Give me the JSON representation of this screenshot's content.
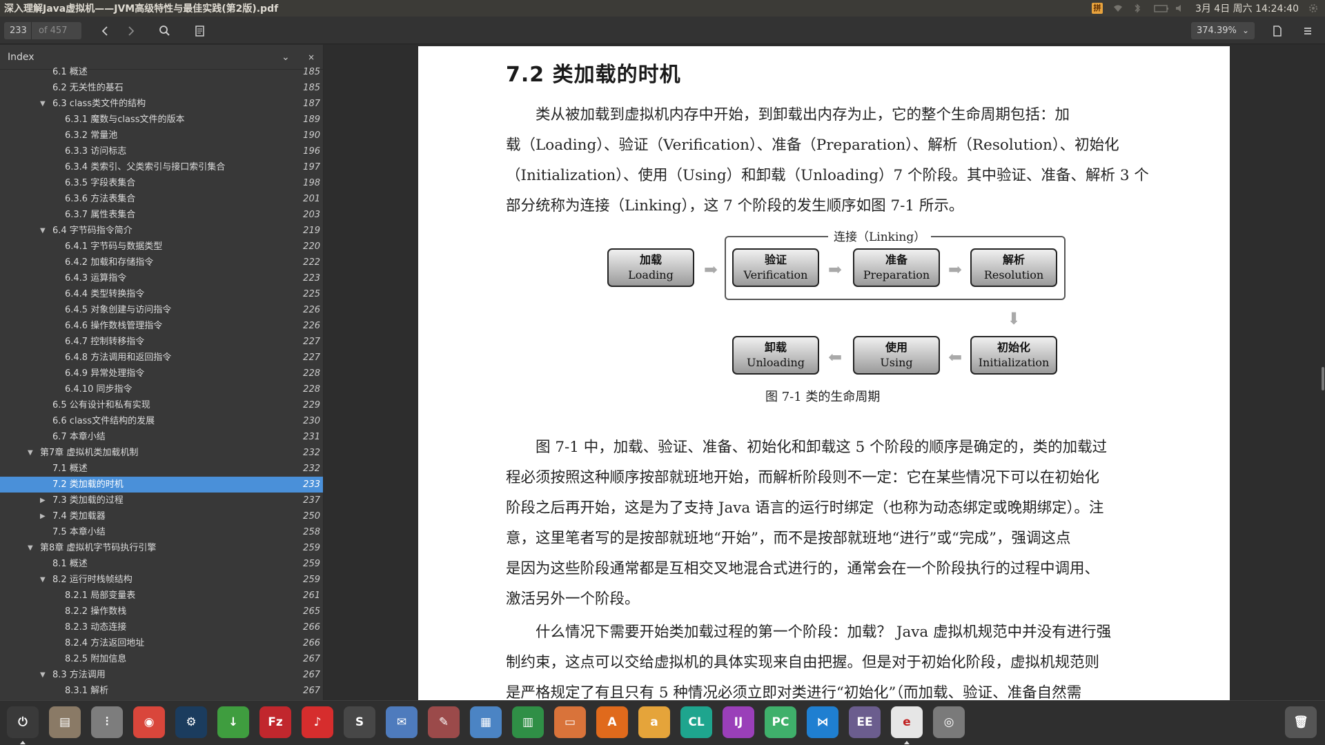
{
  "window": {
    "title": "深入理解Java虚拟机——JVM高级特性与最佳实践(第2版).pdf"
  },
  "tray": {
    "ime_label": "拼",
    "datetime": "3月 4日 周六 14:24:40"
  },
  "toolbar": {
    "current_page": "233",
    "total_pages": "of 457",
    "zoom": "374.39%"
  },
  "sidebar": {
    "title": "Index",
    "close_glyph": "×",
    "dropdown_glyph": "⌄",
    "items": [
      {
        "label": "6.1    概述",
        "page": "185",
        "level": 1,
        "twisty": ""
      },
      {
        "label": "6.2    无关性的基石",
        "page": "185",
        "level": 1,
        "twisty": ""
      },
      {
        "label": "6.3 class类文件的结构",
        "page": "187",
        "level": 1,
        "twisty": "open"
      },
      {
        "label": "6.3.1    魔数与class文件的版本",
        "page": "189",
        "level": 2,
        "twisty": ""
      },
      {
        "label": "6.3.2    常量池",
        "page": "190",
        "level": 2,
        "twisty": ""
      },
      {
        "label": "6.3.3    访问标志",
        "page": "196",
        "level": 2,
        "twisty": ""
      },
      {
        "label": "6.3.4    类索引、父类索引与接口索引集合",
        "page": "197",
        "level": 2,
        "twisty": ""
      },
      {
        "label": "6.3.5    字段表集合",
        "page": "198",
        "level": 2,
        "twisty": ""
      },
      {
        "label": "6.3.6    方法表集合",
        "page": "201",
        "level": 2,
        "twisty": ""
      },
      {
        "label": "6.3.7    属性表集合",
        "page": "203",
        "level": 2,
        "twisty": ""
      },
      {
        "label": "6.4    字节码指令简介",
        "page": "219",
        "level": 1,
        "twisty": "open"
      },
      {
        "label": "6.4.1    字节码与数据类型",
        "page": "220",
        "level": 2,
        "twisty": ""
      },
      {
        "label": "6.4.2    加载和存储指令",
        "page": "222",
        "level": 2,
        "twisty": ""
      },
      {
        "label": "6.4.3    运算指令",
        "page": "223",
        "level": 2,
        "twisty": ""
      },
      {
        "label": "6.4.4    类型转换指令",
        "page": "225",
        "level": 2,
        "twisty": ""
      },
      {
        "label": "6.4.5    对象创建与访问指令",
        "page": "226",
        "level": 2,
        "twisty": ""
      },
      {
        "label": "6.4.6    操作数栈管理指令",
        "page": "226",
        "level": 2,
        "twisty": ""
      },
      {
        "label": "6.4.7    控制转移指令",
        "page": "227",
        "level": 2,
        "twisty": ""
      },
      {
        "label": "6.4.8    方法调用和返回指令",
        "page": "227",
        "level": 2,
        "twisty": ""
      },
      {
        "label": "6.4.9    异常处理指令",
        "page": "228",
        "level": 2,
        "twisty": ""
      },
      {
        "label": "6.4.10    同步指令",
        "page": "228",
        "level": 2,
        "twisty": ""
      },
      {
        "label": "6.5    公有设计和私有实现",
        "page": "229",
        "level": 1,
        "twisty": ""
      },
      {
        "label": "6.6 class文件结构的发展",
        "page": "230",
        "level": 1,
        "twisty": ""
      },
      {
        "label": "6.7    本章小结",
        "page": "231",
        "level": 1,
        "twisty": ""
      },
      {
        "label": "第7章    虚拟机类加载机制",
        "page": "232",
        "level": 0,
        "twisty": "open"
      },
      {
        "label": "7.1    概述",
        "page": "232",
        "level": 1,
        "twisty": ""
      },
      {
        "label": "7.2    类加载的时机",
        "page": "233",
        "level": 1,
        "twisty": "",
        "selected": true
      },
      {
        "label": "7.3    类加载的过程",
        "page": "237",
        "level": 1,
        "twisty": "closed"
      },
      {
        "label": "7.4    类加载器",
        "page": "250",
        "level": 1,
        "twisty": "closed"
      },
      {
        "label": "7.5    本章小结",
        "page": "258",
        "level": 1,
        "twisty": ""
      },
      {
        "label": "第8章    虚拟机字节码执行引擎",
        "page": "259",
        "level": 0,
        "twisty": "open"
      },
      {
        "label": "8.1    概述",
        "page": "259",
        "level": 1,
        "twisty": ""
      },
      {
        "label": "8.2    运行时栈帧结构",
        "page": "259",
        "level": 1,
        "twisty": "open"
      },
      {
        "label": "8.2.1    局部变量表",
        "page": "261",
        "level": 2,
        "twisty": ""
      },
      {
        "label": "8.2.2    操作数栈",
        "page": "265",
        "level": 2,
        "twisty": ""
      },
      {
        "label": "8.2.3    动态连接",
        "page": "266",
        "level": 2,
        "twisty": ""
      },
      {
        "label": "8.2.4    方法返回地址",
        "page": "266",
        "level": 2,
        "twisty": ""
      },
      {
        "label": "8.2.5    附加信息",
        "page": "267",
        "level": 2,
        "twisty": ""
      },
      {
        "label": "8.3    方法调用",
        "page": "267",
        "level": 1,
        "twisty": "open"
      },
      {
        "label": "8.3.1    解析",
        "page": "267",
        "level": 2,
        "twisty": ""
      }
    ]
  },
  "document": {
    "heading": "7.2    类加载的时机",
    "para1": [
      "　　类从被加载到虚拟机内存中开始，到卸载出内存为止，它的整个生命周期包括：加",
      "载（Loading）、验证（Verification）、准备（Preparation）、解析（Resolution）、初始化",
      "（Initialization）、使用（Using）和卸载（Unloading）7 个阶段。其中验证、准备、解析 3 个",
      "部分统称为连接（Linking），这 7 个阶段的发生顺序如图 7-1 所示。"
    ],
    "diagram": {
      "linking_label": "连接（Linking）",
      "stages": {
        "loading": {
          "cn": "加载",
          "en": "Loading"
        },
        "verification": {
          "cn": "验证",
          "en": "Verification"
        },
        "preparation": {
          "cn": "准备",
          "en": "Preparation"
        },
        "resolution": {
          "cn": "解析",
          "en": "Resolution"
        },
        "unloading": {
          "cn": "卸载",
          "en": "Unloading"
        },
        "using": {
          "cn": "使用",
          "en": "Using"
        },
        "initialization": {
          "cn": "初始化",
          "en": "Initialization"
        }
      },
      "caption": "图 7-1    类的生命周期"
    },
    "para2": [
      "　　图 7-1 中，加载、验证、准备、初始化和卸载这 5 个阶段的顺序是确定的，类的加载过",
      "程必须按照这种顺序按部就班地开始，而解析阶段则不一定：它在某些情况下可以在初始化",
      "阶段之后再开始，这是为了支持 Java 语言的运行时绑定（也称为动态绑定或晚期绑定）。注",
      "意，这里笔者写的是按部就班地“开始”，而不是按部就班地“进行”或“完成”，强调这点",
      "是因为这些阶段通常都是互相交叉地混合式进行的，通常会在一个阶段执行的过程中调用、",
      "激活另外一个阶段。"
    ],
    "para3": [
      "　　什么情况下需要开始类加载过程的第一个阶段：加载？ Java 虚拟机规范中并没有进行强",
      "制约束，这点可以交给虚拟机的具体实现来自由把握。但是对于初始化阶段，虚拟机规范则",
      "是严格规定了有且只有 5 种情况必须立即对类进行“初始化”（而加载、验证、准备自然需"
    ]
  },
  "dock": {
    "apps": [
      {
        "name": "system-settings-app-icon",
        "label": "⏻",
        "color": "#3a3a3a",
        "running": true
      },
      {
        "name": "file-manager-app-icon",
        "label": "▤",
        "color": "#8a7a66",
        "running": false
      },
      {
        "name": "sound-mixer-app-icon",
        "label": "⫶",
        "color": "#7d7d7d",
        "running": false
      },
      {
        "name": "chrome-app-icon",
        "label": "◉",
        "color": "#d9463b",
        "running": false
      },
      {
        "name": "steam-app-icon",
        "label": "⚙",
        "color": "#1b3c5e",
        "running": false
      },
      {
        "name": "download-manager-app-icon",
        "label": "↓",
        "color": "#3f9d3f",
        "running": false
      },
      {
        "name": "filezilla-app-icon",
        "label": "Fz",
        "color": "#c1272d",
        "running": false
      },
      {
        "name": "netease-music-app-icon",
        "label": "♪",
        "color": "#d62d2d",
        "running": false
      },
      {
        "name": "sublime-text-app-icon",
        "label": "S",
        "color": "#474747",
        "running": false
      },
      {
        "name": "thunderbird-app-icon",
        "label": "✉",
        "color": "#4e7bbd",
        "running": false
      },
      {
        "name": "system-tools-app-icon",
        "label": "✎",
        "color": "#9b4a4a",
        "running": false
      },
      {
        "name": "image-viewer-app-icon",
        "label": "▦",
        "color": "#4b84c4",
        "running": false
      },
      {
        "name": "spreadsheet-app-icon",
        "label": "▥",
        "color": "#2f8f46",
        "running": false
      },
      {
        "name": "presentation-app-icon",
        "label": "▭",
        "color": "#d9733a",
        "running": false
      },
      {
        "name": "software-center-app-icon",
        "label": "A",
        "color": "#e06a1c",
        "running": false
      },
      {
        "name": "amazon-app-icon",
        "label": "a",
        "color": "#e5a43a",
        "running": false
      },
      {
        "name": "clion-app-icon",
        "label": "CL",
        "color": "#1ea58e",
        "running": false
      },
      {
        "name": "intellij-app-icon",
        "label": "IJ",
        "color": "#9a3fb9",
        "running": false
      },
      {
        "name": "pycharm-app-icon",
        "label": "PC",
        "color": "#3fb06b",
        "running": false
      },
      {
        "name": "vscode-app-icon",
        "label": "⋈",
        "color": "#1f7fd1",
        "running": false
      },
      {
        "name": "eclipse-app-icon",
        "label": "EE",
        "color": "#6b5d8e",
        "running": false
      },
      {
        "name": "pdf-reader-app-icon",
        "label": "e",
        "color": "#e6e6e6",
        "running": true
      },
      {
        "name": "camera-app-icon",
        "label": "◎",
        "color": "#7a7a7a",
        "running": false
      }
    ],
    "trash_label": "🗑"
  }
}
